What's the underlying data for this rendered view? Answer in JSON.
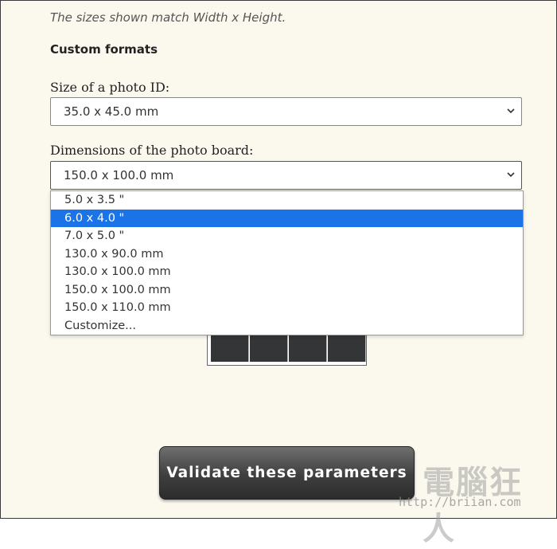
{
  "intro_note": "The sizes shown match Width x Height.",
  "section_title": "Custom formats",
  "photo_id": {
    "label": "Size of a photo ID:",
    "value": "35.0 x 45.0 mm"
  },
  "photo_board": {
    "label": "Dimensions of the photo board:",
    "value": "150.0 x 100.0 mm",
    "options": [
      "5.0 x 3.5 \"",
      "6.0 x 4.0 \"",
      "7.0 x 5.0 \"",
      "130.0 x 90.0 mm",
      "130.0 x 100.0 mm",
      "150.0 x 100.0 mm",
      "150.0 x 110.0 mm",
      "Customize..."
    ],
    "highlighted_option": "6.0 x 4.0 \""
  },
  "validate_button_label": "Validate these parameters",
  "watermark": {
    "text": "電腦狂人",
    "url": "http://briian.com"
  },
  "colors": {
    "background": "#fbf8ee",
    "highlight": "#1a74e8",
    "button": "#3f3f3f"
  }
}
